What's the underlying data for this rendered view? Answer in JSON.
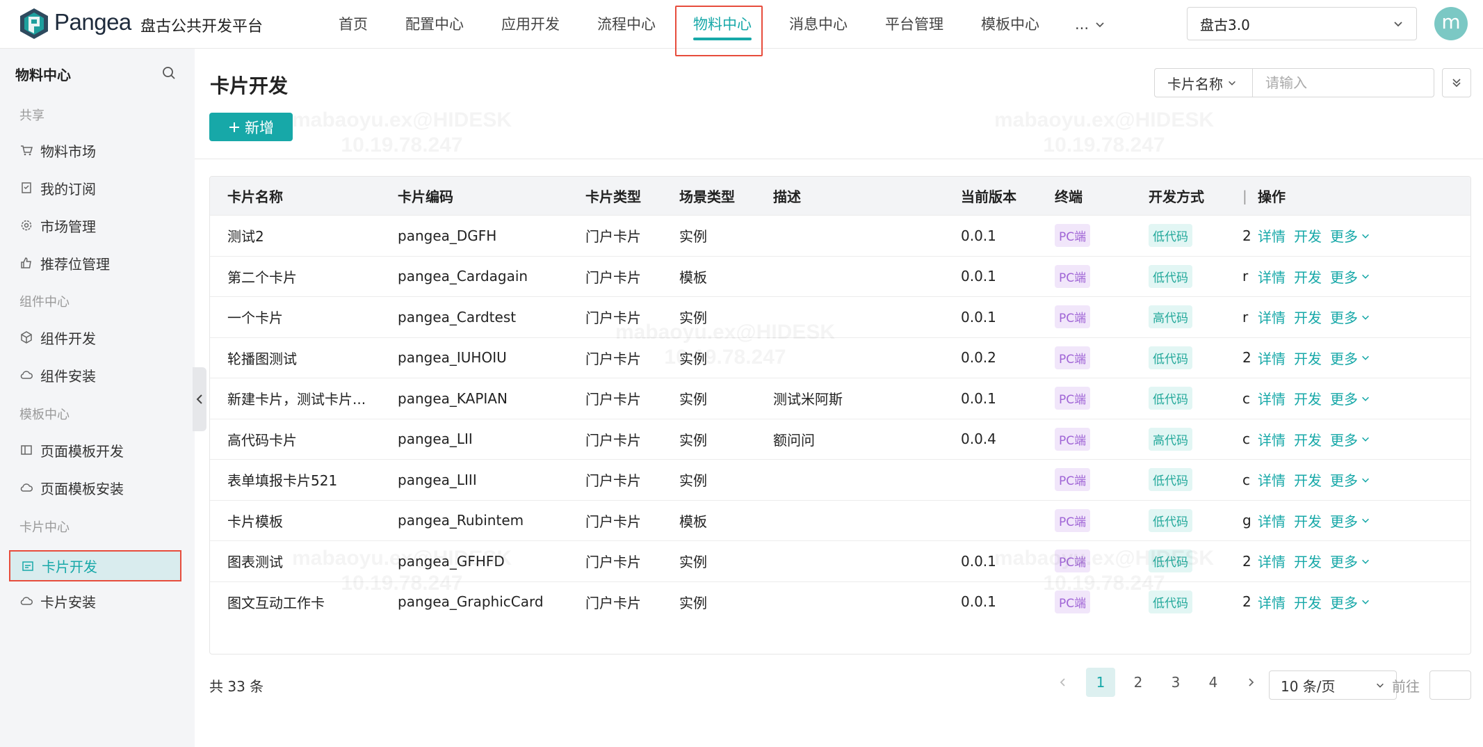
{
  "header": {
    "brand": "Pangea",
    "subtitle": "盘古公共开发平台",
    "nav": [
      "首页",
      "配置中心",
      "应用开发",
      "流程中心",
      "物料中心",
      "消息中心",
      "平台管理",
      "模板中心"
    ],
    "nav_active_index": 4,
    "nav_more": "...",
    "env": "盘古3.0",
    "avatar_letter": "m"
  },
  "sidebar": {
    "title": "物料中心",
    "groups": [
      {
        "label": "共享",
        "items": [
          {
            "label": "物料市场",
            "icon": "cart-icon"
          },
          {
            "label": "我的订阅",
            "icon": "bookmark-icon"
          },
          {
            "label": "市场管理",
            "icon": "gear-icon"
          },
          {
            "label": "推荐位管理",
            "icon": "thumb-up-icon"
          }
        ]
      },
      {
        "label": "组件中心",
        "items": [
          {
            "label": "组件开发",
            "icon": "cube-icon"
          },
          {
            "label": "组件安装",
            "icon": "cloud-icon"
          }
        ]
      },
      {
        "label": "模板中心",
        "items": [
          {
            "label": "页面模板开发",
            "icon": "layout-icon"
          },
          {
            "label": "页面模板安装",
            "icon": "cloud-icon"
          }
        ]
      },
      {
        "label": "卡片中心",
        "items": [
          {
            "label": "卡片开发",
            "icon": "card-icon",
            "active": true
          },
          {
            "label": "卡片安装",
            "icon": "cloud-icon"
          }
        ]
      }
    ]
  },
  "main": {
    "title": "卡片开发",
    "add_label": "新增",
    "filter": {
      "field": "卡片名称",
      "placeholder": "请输入"
    },
    "columns": [
      "卡片名称",
      "卡片编码",
      "卡片类型",
      "场景类型",
      "描述",
      "当前版本",
      "终端",
      "开发方式",
      "",
      "操作"
    ],
    "rows": [
      {
        "name": "测试2",
        "code": "pangea_DGFH",
        "type": "门户卡片",
        "scene": "实例",
        "desc": "",
        "version": "0.0.1",
        "terminal": "PC端",
        "dev": "低代码",
        "extra": "2"
      },
      {
        "name": "第二个卡片",
        "code": "pangea_Cardagain",
        "type": "门户卡片",
        "scene": "模板",
        "desc": "",
        "version": "0.0.1",
        "terminal": "PC端",
        "dev": "低代码",
        "extra": "r"
      },
      {
        "name": "一个卡片",
        "code": "pangea_Cardtest",
        "type": "门户卡片",
        "scene": "实例",
        "desc": "",
        "version": "0.0.1",
        "terminal": "PC端",
        "dev": "高代码",
        "extra": "r"
      },
      {
        "name": "轮播图测试",
        "code": "pangea_IUHOIU",
        "type": "门户卡片",
        "scene": "实例",
        "desc": "",
        "version": "0.0.2",
        "terminal": "PC端",
        "dev": "低代码",
        "extra": "2"
      },
      {
        "name": "新建卡片，测试卡片...",
        "code": "pangea_KAPIAN",
        "type": "门户卡片",
        "scene": "实例",
        "desc": "测试米阿斯",
        "version": "0.0.1",
        "terminal": "PC端",
        "dev": "低代码",
        "extra": "c"
      },
      {
        "name": "高代码卡片",
        "code": "pangea_LII",
        "type": "门户卡片",
        "scene": "实例",
        "desc": "额问问",
        "version": "0.0.4",
        "terminal": "PC端",
        "dev": "高代码",
        "extra": "c"
      },
      {
        "name": "表单填报卡片521",
        "code": "pangea_LIII",
        "type": "门户卡片",
        "scene": "实例",
        "desc": "",
        "version": "",
        "terminal": "PC端",
        "dev": "低代码",
        "extra": "c"
      },
      {
        "name": "卡片模板",
        "code": "pangea_Rubintem",
        "type": "门户卡片",
        "scene": "模板",
        "desc": "",
        "version": "",
        "terminal": "PC端",
        "dev": "低代码",
        "extra": "g"
      },
      {
        "name": "图表测试",
        "code": "pangea_GFHFD",
        "type": "门户卡片",
        "scene": "实例",
        "desc": "",
        "version": "0.0.1",
        "terminal": "PC端",
        "dev": "低代码",
        "extra": "2"
      },
      {
        "name": "图文互动工作卡",
        "code": "pangea_GraphicCard",
        "type": "门户卡片",
        "scene": "实例",
        "desc": "",
        "version": "0.0.1",
        "terminal": "PC端",
        "dev": "低代码",
        "extra": "2"
      }
    ],
    "actions": {
      "detail": "详情",
      "develop": "开发",
      "more": "更多"
    },
    "total": "共 33 条",
    "pages": [
      "1",
      "2",
      "3",
      "4"
    ],
    "page_active": "1",
    "page_size": "10 条/页",
    "goto": "前往"
  },
  "watermark": {
    "user": "mabaoyu.ex@HIDESK",
    "ip": "10.19.78.247"
  },
  "colors": {
    "accent": "#17a8a8",
    "highlight": "#e74c3c",
    "pc_tag": "#a065d6"
  }
}
